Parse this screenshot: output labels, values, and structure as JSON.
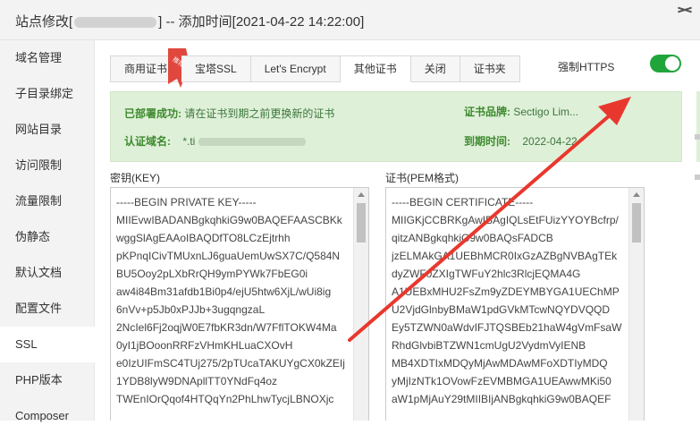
{
  "window": {
    "title_prefix": "站点修改[",
    "title_suffix": "] -- 添加时间[2021-04-22 14:22:00]"
  },
  "sidebar": {
    "items": [
      {
        "label": "域名管理"
      },
      {
        "label": "子目录绑定"
      },
      {
        "label": "网站目录"
      },
      {
        "label": "访问限制"
      },
      {
        "label": "流量限制"
      },
      {
        "label": "伪静态"
      },
      {
        "label": "默认文档"
      },
      {
        "label": "配置文件"
      },
      {
        "label": "SSL"
      },
      {
        "label": "PHP版本"
      },
      {
        "label": "Composer"
      }
    ],
    "active": "SSL"
  },
  "tabs": [
    {
      "label": "商用证书"
    },
    {
      "label": "宝塔SSL"
    },
    {
      "label": "Let's Encrypt"
    },
    {
      "label": "其他证书"
    },
    {
      "label": "关闭"
    },
    {
      "label": "证书夹"
    }
  ],
  "active_tab": "其他证书",
  "tab_badge": "推荐",
  "https": {
    "label": "强制HTTPS",
    "enabled": true
  },
  "info": {
    "deployed_key": "已部署成功:",
    "deployed_value": "请在证书到期之前更换新的证书",
    "domain_key": "认证域名:",
    "domain_value_prefix": "*.ti",
    "brand_key": "证书品牌:",
    "brand_value": "Sectigo Lim...",
    "expire_key": "到期时间:",
    "expire_value": "2022-04-22"
  },
  "key_field": {
    "label": "密钥(KEY)",
    "lines": [
      "-----BEGIN PRIVATE KEY-----",
      "MIIEvwIBADANBgkqhkiG9w0BAQEFAASCBKk",
      "wggSlAgEAAoIBAQDfTO8LCzEjtrhh",
      "pKPnqICivTMUxnLJ6guaUemUwSX7C/Q584N",
      "BU5Ooy2pLXbRrQH9ymPYWk7FbEG0i",
      "aw4i84Bm31afdb1Bi0p4/ejU5htw6XjL/wUi8ig",
      "6nVv+p5Jb0xPJJb+3ugqngzaL",
      "2NcIel6Fj2oqjW0E7fbKR3dn/W7FflTOKW4Ma",
      "0yI1jBOoonRRFzVHmKHLuaCXOvH",
      "e0IzUIFmSC4TUj275/2pTUcaTAKUYgCX0kZEIj",
      "1YDB8lyW9DNApllTT0YNdFq4oz",
      "TWEnIOrQqof4HTQqYn2PhLhwTycjLBNOXjc"
    ]
  },
  "cert_field": {
    "label": "证书(PEM格式)",
    "lines": [
      "-----BEGIN CERTIFICATE-----",
      "MIIGKjCCBRKgAwIBAgIQLsEtFUizYYOYBcfrp/",
      "qitzANBgkqhkiG9w0BAQsFADCB",
      "jzELMAkGA1UEBhMCR0IxGzAZBgNVBAgTEk",
      "dyZWF0ZXIgTWFuY2hlc3RlcjEQMA4G",
      "A1UEBxMHU2FsZm9yZDEYMBYGA1UEChMP",
      "U2VjdGlnbyBMaW1pdGVkMTcwNQYDVQQD",
      "Ey5TZWN0aWdvIFJTQSBEb21haW4gVmFsaW",
      "RhdGlvbiBTZWN1cmUgU2VydmVyIENB",
      "MB4XDTIxMDQyMjAwMDAwMFoXDTIyMDQ",
      "yMjIzNTk1OVowFzEVMBMGA1UEAwwMKi50",
      "aW1pMjAuY29tMIIBIjANBgkqhkiG9w0BAQEF"
    ]
  },
  "colors": {
    "toggle_on": "#20a53a",
    "success_bg": "#dff0d8",
    "annotation_arrow": "#e8382e"
  },
  "icons": {
    "badge": "ribbon-badge-icon",
    "close": "close-icon",
    "arrow": "annotation-arrow-icon"
  }
}
